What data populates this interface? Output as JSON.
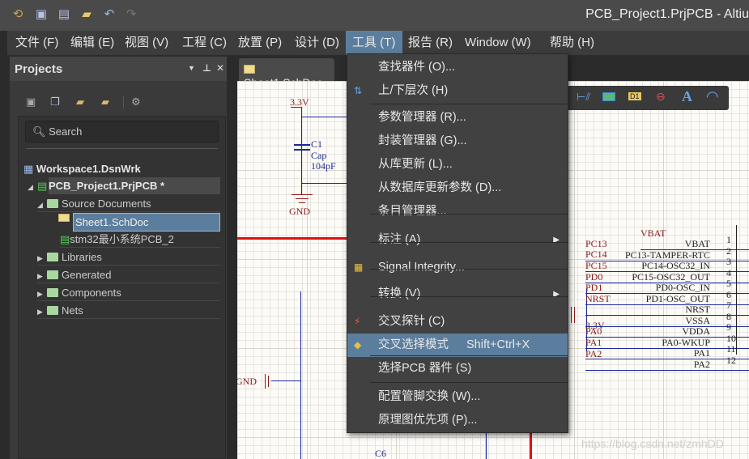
{
  "window": {
    "title": "PCB_Project1.PrjPCB - Altiu"
  },
  "quick_access": [
    "app-logo-icon",
    "save-icon",
    "save-all-icon",
    "open-icon",
    "undo-icon",
    "redo-icon"
  ],
  "menubar": [
    "文件 (F)",
    "编辑 (E)",
    "视图 (V)",
    "工程 (C)",
    "放置 (P)",
    "设计 (D)",
    "工具 (T)",
    "报告 (R)",
    "Window (W)",
    "帮助 (H)"
  ],
  "panel": {
    "title": "Projects",
    "search_placeholder": "Search",
    "tree": {
      "workspace": "Workspace1.DsnWrk",
      "project": "PCB_Project1.PrjPCB *",
      "source": "Source Documents",
      "sheet": "Sheet1.SchDoc",
      "pcb": "stm32最小系统PCB_2",
      "libraries": "Libraries",
      "generated": "Generated",
      "components": "Components",
      "nets": "Nets"
    }
  },
  "doc_tab": "Sheet1.SchDoc",
  "tools_menu": [
    {
      "label": "查找器件 (O)..."
    },
    {
      "label": "上/下层次 (H)"
    },
    {
      "label": "参数管理器 (R)..."
    },
    {
      "label": "封装管理器 (G)..."
    },
    {
      "label": "从库更新 (L)..."
    },
    {
      "label": "从数据库更新参数 (D)..."
    },
    {
      "label": "条目管理器..."
    },
    {
      "label": "标注 (A)"
    },
    {
      "label": "Signal Integrity..."
    },
    {
      "label": "转换 (V)"
    },
    {
      "label": "交叉探针 (C)"
    },
    {
      "label": "交叉选择模式",
      "shortcut": "Shift+Ctrl+X"
    },
    {
      "label": "选择PCB 器件 (S)"
    },
    {
      "label": "配置管脚交换 (W)..."
    },
    {
      "label": "原理图优先项 (P)..."
    }
  ],
  "schematic": {
    "c1": {
      "power": "3.3V",
      "ref": "C1",
      "type": "Cap",
      "value": "104pF",
      "gnd": "GND"
    },
    "gnd_left": "GND",
    "c6": "C6",
    "nets": [
      "VBAT",
      "PC13",
      "PC14",
      "PC15",
      "PD0",
      "PD1",
      "NRST",
      "3.3V",
      "PA0",
      "PA1",
      "PA2"
    ],
    "pins": [
      [
        "VBAT",
        "1"
      ],
      [
        "PC13-TAMPER-RTC",
        "2"
      ],
      [
        "PC14-OSC32_IN",
        "3"
      ],
      [
        "PC15-OSC32_OUT",
        "4"
      ],
      [
        "PD0-OSC_IN",
        "5"
      ],
      [
        "PD1-OSC_OUT",
        "6"
      ],
      [
        "NRST",
        "7"
      ],
      [
        "VSSA",
        "8"
      ],
      [
        "VDDA",
        "9"
      ],
      [
        "PA0-WKUP",
        "10"
      ],
      [
        "PA1",
        "11"
      ],
      [
        "PA2",
        "12"
      ]
    ]
  },
  "watermark": "https://blog.csdn.net/zmhDD",
  "colors": {
    "menu_highlight": "#5c7e9e",
    "net_label": "#8b1a1a",
    "wire": "#1a2a9a"
  }
}
